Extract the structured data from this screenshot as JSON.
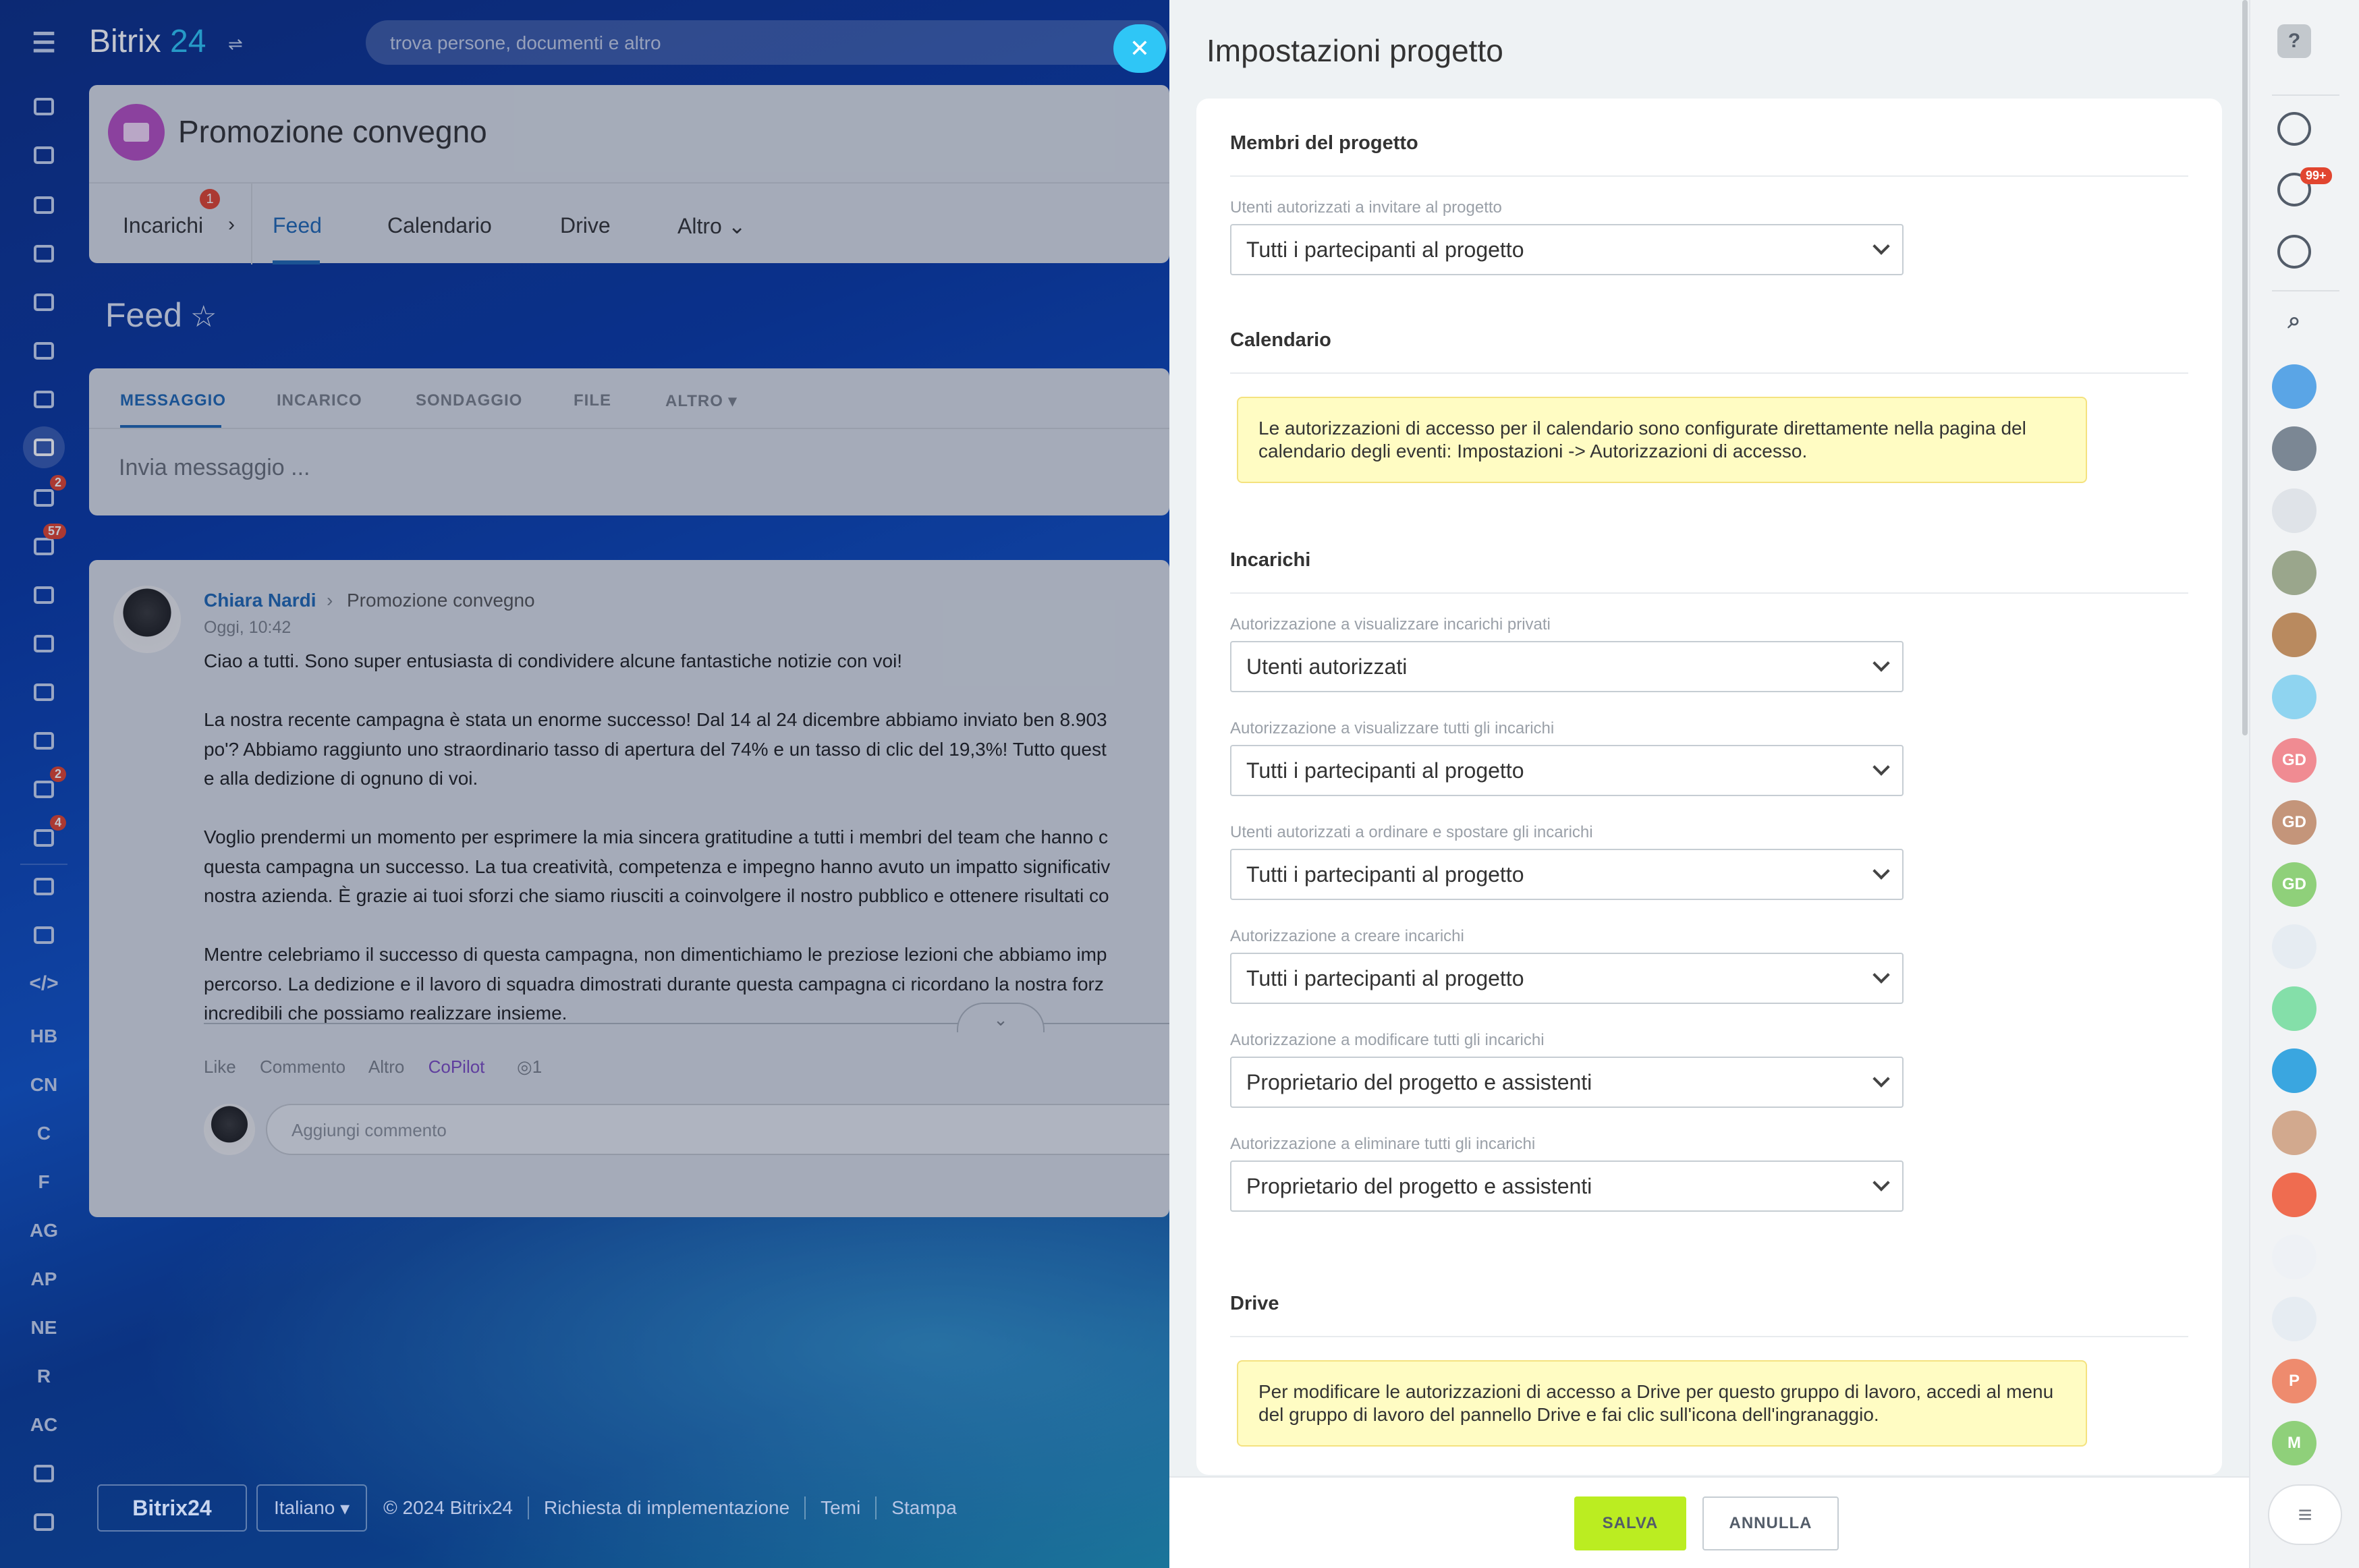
{
  "header": {
    "logo_prefix": "Bitrix",
    "logo_num": "24",
    "search_placeholder": "trova persone, documenti e altro"
  },
  "left_rail": {
    "badges": {
      "tasks": "2",
      "feed": "57",
      "contacts": "2",
      "bot": "4"
    },
    "letters": [
      "HB",
      "CN",
      "C",
      "F",
      "AG",
      "AP",
      "NE",
      "R",
      "AC"
    ]
  },
  "project": {
    "title": "Promozione convegno",
    "tabs": {
      "incarichi": "Incarichi",
      "incarichi_badge": "1",
      "feed": "Feed",
      "calendario": "Calendario",
      "drive": "Drive",
      "altro": "Altro"
    }
  },
  "feed": {
    "title": "Feed",
    "composer_tabs": [
      "MESSAGGIO",
      "INCARICO",
      "SONDAGGIO",
      "FILE",
      "ALTRO"
    ],
    "composer_placeholder": "Invia messaggio ..."
  },
  "post": {
    "author": "Chiara Nardi",
    "group": "Promozione convegno",
    "date": "Oggi, 10:42",
    "paragraphs": [
      "Ciao a tutti. Sono super entusiasta di condividere alcune fantastiche notizie con voi!",
      "La nostra recente campagna è stata un enorme successo! Dal 14 al 24 dicembre abbiamo inviato ben 8.903\npo'? Abbiamo raggiunto uno straordinario tasso di apertura del 74% e un tasso di clic del 19,3%! Tutto quest\ne alla dedizione di ognuno di voi.",
      "Voglio prendermi un momento per esprimere la mia sincera gratitudine a tutti i membri del team che hanno c\nquesta campagna un successo. La tua creatività, competenza e impegno hanno avuto un impatto significativ\nnostra azienda. È grazie ai tuoi sforzi che siamo riusciti a coinvolgere il nostro pubblico e ottenere risultati co",
      "Mentre celebriamo il successo di questa campagna, non dimentichiamo le preziose lezioni che abbiamo imp\npercorso. La dedizione e il lavoro di squadra dimostrati durante questa campagna ci ricordano la nostra forz\nincredibili che possiamo realizzare insieme."
    ],
    "actions": {
      "like": "Like",
      "comment": "Commento",
      "more": "Altro",
      "copilot": "CoPilot"
    },
    "views": "1",
    "comment_placeholder": "Aggiungi commento"
  },
  "footer": {
    "logo": "Bitrix24",
    "language": "Italiano",
    "copyright": "© 2024 Bitrix24",
    "links": [
      "Richiesta di implementazione",
      "Temi",
      "Stampa"
    ]
  },
  "panel": {
    "title": "Impostazioni progetto",
    "members": {
      "title": "Membri del progetto",
      "invite_label": "Utenti autorizzati a invitare al progetto",
      "invite_value": "Tutti i partecipanti al progetto"
    },
    "calendar": {
      "title": "Calendario",
      "notice": "Le autorizzazioni di accesso per il calendario sono configurate direttamente nella pagina del calendario degli eventi: Impostazioni -> Autorizzazioni di accesso."
    },
    "tasks": {
      "title": "Incarichi",
      "fields": [
        {
          "label": "Autorizzazione a visualizzare incarichi privati",
          "value": "Utenti autorizzati"
        },
        {
          "label": "Autorizzazione a visualizzare tutti gli incarichi",
          "value": "Tutti i partecipanti al progetto"
        },
        {
          "label": "Utenti autorizzati a ordinare e spostare gli incarichi",
          "value": "Tutti i partecipanti al progetto"
        },
        {
          "label": "Autorizzazione a creare incarichi",
          "value": "Tutti i partecipanti al progetto"
        },
        {
          "label": "Autorizzazione a modificare tutti gli incarichi",
          "value": "Proprietario del progetto e assistenti"
        },
        {
          "label": "Autorizzazione a eliminare tutti gli incarichi",
          "value": "Proprietario del progetto e assistenti"
        }
      ]
    },
    "drive": {
      "title": "Drive",
      "notice": "Per modificare le autorizzazioni di accesso a Drive per questo gruppo di lavoro, accedi al menu del gruppo di lavoro del pannello Drive e fai clic sull'icona dell'ingranaggio."
    },
    "buttons": {
      "save": "SALVA",
      "cancel": "ANNULLA"
    }
  },
  "right_rail": {
    "notifications_badge": "99+",
    "initials": [
      "GD",
      "GD",
      "GD",
      "P",
      "M"
    ]
  },
  "colors": {
    "accent_blue": "#2067b0",
    "cyan": "#2fc6f6",
    "save_green": "#bbed21",
    "badge_red": "#e1452f",
    "notice_yellow": "#fffcc3"
  }
}
